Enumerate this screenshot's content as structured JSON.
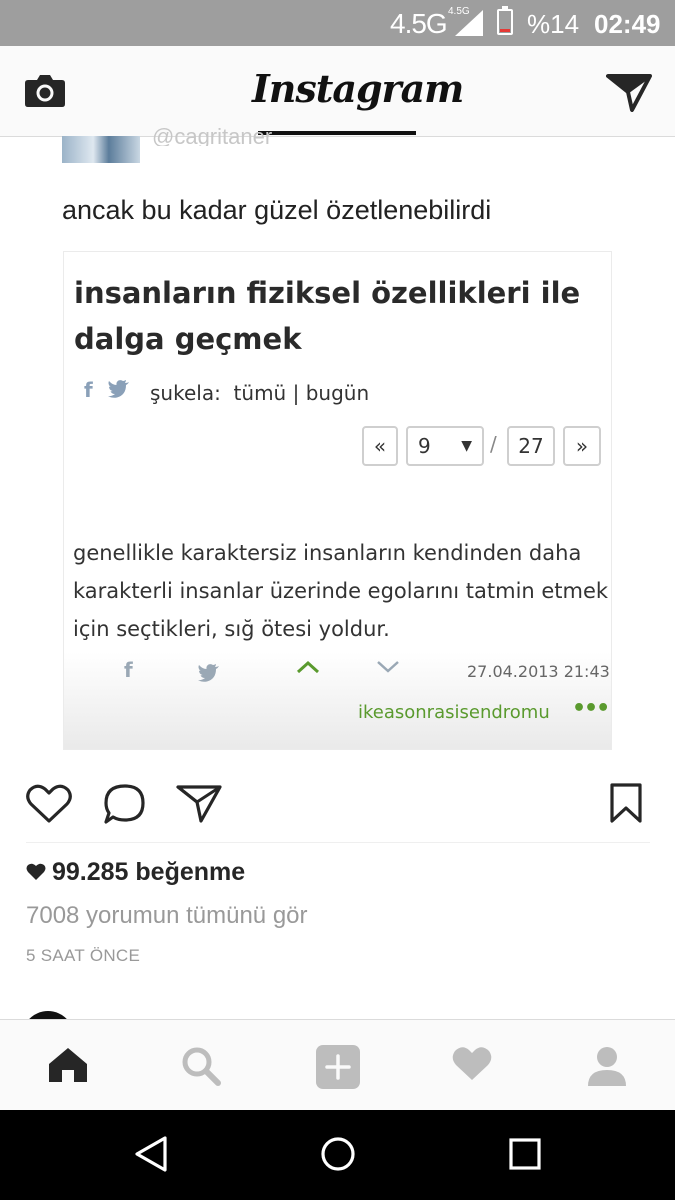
{
  "status_bar": {
    "network": "4.5G",
    "network_small": "4.5G",
    "battery_percent": "%14",
    "battery_level": 0.14,
    "time": "02:49"
  },
  "header": {
    "title": "Instagram",
    "left_icon": "camera-icon",
    "right_icon": "direct-message-icon"
  },
  "post": {
    "author_handle": "@cagritaner",
    "text": "ancak bu kadar güzel özetlenebilirdi",
    "embedded": {
      "heading_line1": "insanların fiziksel özellikleri ile",
      "heading_line2": "dalga geçmek",
      "share_fb": "f",
      "sukela_label": "şukela:",
      "filter_all": "tümü",
      "filter_sep": "|",
      "filter_today": "bugün",
      "pager_prev": "«",
      "pager_current": "9",
      "pager_sep": "/",
      "pager_total": "27",
      "pager_next": "»",
      "body_line1": "genellikle karaktersiz insanların kendinden daha",
      "body_line2": "karakterli insanlar üzerinde egolarını tatmin etmek",
      "body_line3": "için seçtikleri, sığ ötesi yoldur.",
      "footer_fb": "f",
      "date": "27.04.2013 21:43",
      "author": "ikeasonrasisendromu",
      "more": "•••",
      "accent_color": "#5a9a2e"
    },
    "likes": "99.285 beğenme",
    "comments_link": "7008 yorumun tümünü gör",
    "time_ago": "5 SAAT ÖNCE"
  },
  "tab_bar": {
    "items": [
      "home-icon",
      "search-icon",
      "add-icon",
      "activity-icon",
      "profile-icon"
    ],
    "active": "home-icon"
  },
  "nav_bar": {
    "items": [
      "back-icon",
      "home-circle-icon",
      "recents-icon"
    ]
  }
}
